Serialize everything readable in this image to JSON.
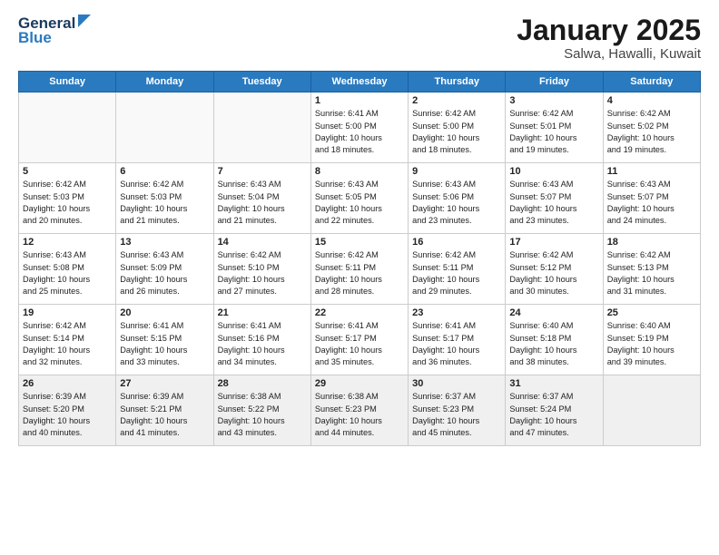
{
  "header": {
    "logo_general": "General",
    "logo_blue": "Blue",
    "month_title": "January 2025",
    "location": "Salwa, Hawalli, Kuwait"
  },
  "weekdays": [
    "Sunday",
    "Monday",
    "Tuesday",
    "Wednesday",
    "Thursday",
    "Friday",
    "Saturday"
  ],
  "weeks": [
    [
      {
        "day": "",
        "info": ""
      },
      {
        "day": "",
        "info": ""
      },
      {
        "day": "",
        "info": ""
      },
      {
        "day": "1",
        "info": "Sunrise: 6:41 AM\nSunset: 5:00 PM\nDaylight: 10 hours\nand 18 minutes."
      },
      {
        "day": "2",
        "info": "Sunrise: 6:42 AM\nSunset: 5:00 PM\nDaylight: 10 hours\nand 18 minutes."
      },
      {
        "day": "3",
        "info": "Sunrise: 6:42 AM\nSunset: 5:01 PM\nDaylight: 10 hours\nand 19 minutes."
      },
      {
        "day": "4",
        "info": "Sunrise: 6:42 AM\nSunset: 5:02 PM\nDaylight: 10 hours\nand 19 minutes."
      }
    ],
    [
      {
        "day": "5",
        "info": "Sunrise: 6:42 AM\nSunset: 5:03 PM\nDaylight: 10 hours\nand 20 minutes."
      },
      {
        "day": "6",
        "info": "Sunrise: 6:42 AM\nSunset: 5:03 PM\nDaylight: 10 hours\nand 21 minutes."
      },
      {
        "day": "7",
        "info": "Sunrise: 6:43 AM\nSunset: 5:04 PM\nDaylight: 10 hours\nand 21 minutes."
      },
      {
        "day": "8",
        "info": "Sunrise: 6:43 AM\nSunset: 5:05 PM\nDaylight: 10 hours\nand 22 minutes."
      },
      {
        "day": "9",
        "info": "Sunrise: 6:43 AM\nSunset: 5:06 PM\nDaylight: 10 hours\nand 23 minutes."
      },
      {
        "day": "10",
        "info": "Sunrise: 6:43 AM\nSunset: 5:07 PM\nDaylight: 10 hours\nand 23 minutes."
      },
      {
        "day": "11",
        "info": "Sunrise: 6:43 AM\nSunset: 5:07 PM\nDaylight: 10 hours\nand 24 minutes."
      }
    ],
    [
      {
        "day": "12",
        "info": "Sunrise: 6:43 AM\nSunset: 5:08 PM\nDaylight: 10 hours\nand 25 minutes."
      },
      {
        "day": "13",
        "info": "Sunrise: 6:43 AM\nSunset: 5:09 PM\nDaylight: 10 hours\nand 26 minutes."
      },
      {
        "day": "14",
        "info": "Sunrise: 6:42 AM\nSunset: 5:10 PM\nDaylight: 10 hours\nand 27 minutes."
      },
      {
        "day": "15",
        "info": "Sunrise: 6:42 AM\nSunset: 5:11 PM\nDaylight: 10 hours\nand 28 minutes."
      },
      {
        "day": "16",
        "info": "Sunrise: 6:42 AM\nSunset: 5:11 PM\nDaylight: 10 hours\nand 29 minutes."
      },
      {
        "day": "17",
        "info": "Sunrise: 6:42 AM\nSunset: 5:12 PM\nDaylight: 10 hours\nand 30 minutes."
      },
      {
        "day": "18",
        "info": "Sunrise: 6:42 AM\nSunset: 5:13 PM\nDaylight: 10 hours\nand 31 minutes."
      }
    ],
    [
      {
        "day": "19",
        "info": "Sunrise: 6:42 AM\nSunset: 5:14 PM\nDaylight: 10 hours\nand 32 minutes."
      },
      {
        "day": "20",
        "info": "Sunrise: 6:41 AM\nSunset: 5:15 PM\nDaylight: 10 hours\nand 33 minutes."
      },
      {
        "day": "21",
        "info": "Sunrise: 6:41 AM\nSunset: 5:16 PM\nDaylight: 10 hours\nand 34 minutes."
      },
      {
        "day": "22",
        "info": "Sunrise: 6:41 AM\nSunset: 5:17 PM\nDaylight: 10 hours\nand 35 minutes."
      },
      {
        "day": "23",
        "info": "Sunrise: 6:41 AM\nSunset: 5:17 PM\nDaylight: 10 hours\nand 36 minutes."
      },
      {
        "day": "24",
        "info": "Sunrise: 6:40 AM\nSunset: 5:18 PM\nDaylight: 10 hours\nand 38 minutes."
      },
      {
        "day": "25",
        "info": "Sunrise: 6:40 AM\nSunset: 5:19 PM\nDaylight: 10 hours\nand 39 minutes."
      }
    ],
    [
      {
        "day": "26",
        "info": "Sunrise: 6:39 AM\nSunset: 5:20 PM\nDaylight: 10 hours\nand 40 minutes."
      },
      {
        "day": "27",
        "info": "Sunrise: 6:39 AM\nSunset: 5:21 PM\nDaylight: 10 hours\nand 41 minutes."
      },
      {
        "day": "28",
        "info": "Sunrise: 6:38 AM\nSunset: 5:22 PM\nDaylight: 10 hours\nand 43 minutes."
      },
      {
        "day": "29",
        "info": "Sunrise: 6:38 AM\nSunset: 5:23 PM\nDaylight: 10 hours\nand 44 minutes."
      },
      {
        "day": "30",
        "info": "Sunrise: 6:37 AM\nSunset: 5:23 PM\nDaylight: 10 hours\nand 45 minutes."
      },
      {
        "day": "31",
        "info": "Sunrise: 6:37 AM\nSunset: 5:24 PM\nDaylight: 10 hours\nand 47 minutes."
      },
      {
        "day": "",
        "info": ""
      }
    ]
  ]
}
